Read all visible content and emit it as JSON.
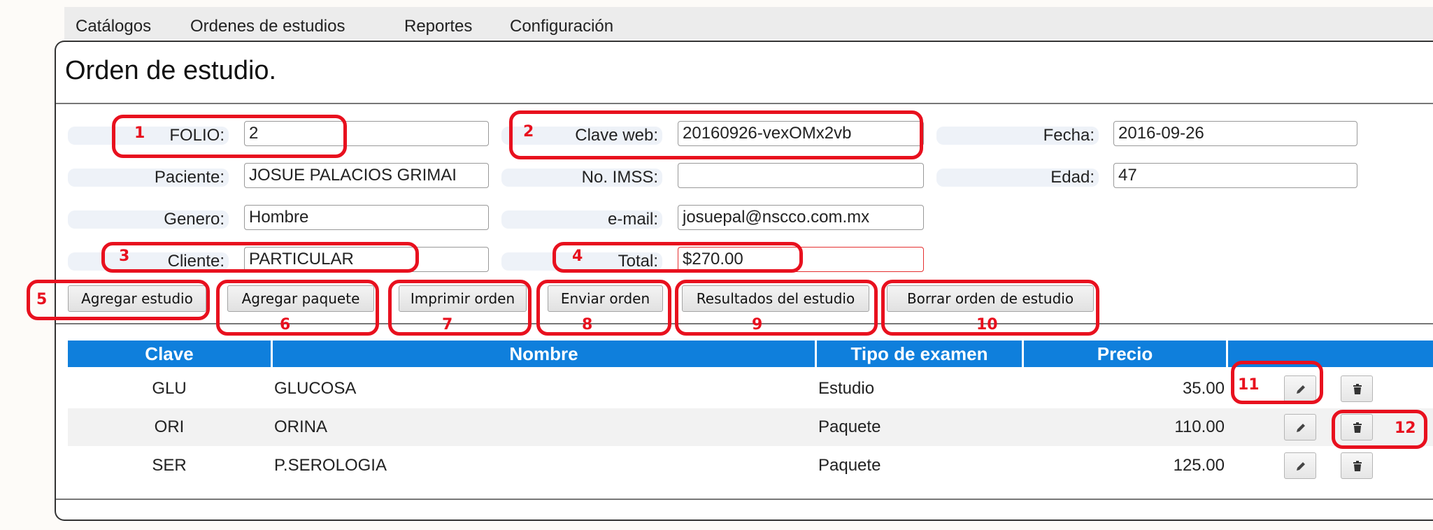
{
  "menu": [
    "Catálogos",
    "Ordenes de estudios",
    "Reportes",
    "Configuración"
  ],
  "page_title": "Orden de estudio.",
  "form": {
    "folio": {
      "label": "FOLIO:",
      "value": "2"
    },
    "clave_web": {
      "label": "Clave web:",
      "value": "20160926-vexOMx2vb"
    },
    "fecha": {
      "label": "Fecha:",
      "value": "2016-09-26"
    },
    "paciente": {
      "label": "Paciente:",
      "value": "JOSUE PALACIOS GRIMAI"
    },
    "imss": {
      "label": "No. IMSS:",
      "value": ""
    },
    "edad": {
      "label": "Edad:",
      "value": "47"
    },
    "genero": {
      "label": "Genero:",
      "value": "Hombre"
    },
    "email": {
      "label": "e-mail:",
      "value": "josuepal@nscco.com.mx"
    },
    "cliente": {
      "label": "Cliente:",
      "value": "PARTICULAR"
    },
    "total": {
      "label": "Total:",
      "value": "$270.00"
    }
  },
  "buttons": {
    "agregar_estudio": "Agregar estudio",
    "agregar_paquete": "Agregar paquete",
    "imprimir_orden": "Imprimir orden",
    "enviar_orden": "Enviar orden",
    "resultados": "Resultados del estudio",
    "borrar_orden": "Borrar orden de estudio"
  },
  "table": {
    "headers": [
      "Clave",
      "Nombre",
      "Tipo de examen",
      "Precio",
      ""
    ],
    "rows": [
      {
        "clave": "GLU",
        "nombre": "GLUCOSA",
        "tipo": "Estudio",
        "precio": "35.00"
      },
      {
        "clave": "ORI",
        "nombre": "ORINA",
        "tipo": "Paquete",
        "precio": "110.00"
      },
      {
        "clave": "SER",
        "nombre": "P.SEROLOGIA",
        "tipo": "Paquete",
        "precio": "125.00"
      }
    ]
  },
  "annotations": [
    "1",
    "2",
    "3",
    "4",
    "5",
    "6",
    "7",
    "8",
    "9",
    "10",
    "11",
    "12"
  ],
  "icons": {
    "edit": "pencil-icon",
    "delete": "trash-icon"
  },
  "colors": {
    "table_header": "#0f7fdc",
    "annotation": "#e8101e",
    "row_alt": "#f2f2f2"
  }
}
